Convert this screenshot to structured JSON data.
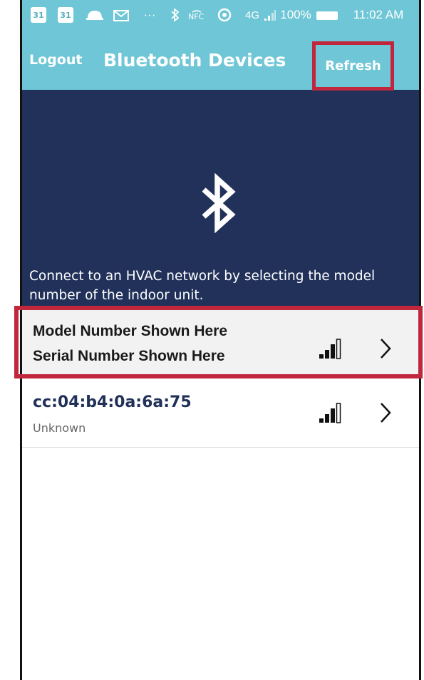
{
  "status_bar": {
    "cal_1": "31",
    "cal_2": "31",
    "network": "4G",
    "battery": "100%",
    "time": "11:02 AM",
    "icons": [
      "calendar-icon",
      "calendar-icon",
      "hat-icon",
      "mail-icon",
      "more-icon",
      "bluetooth-icon",
      "nfc-icon",
      "sync-icon",
      "signal-icon",
      "battery-icon"
    ]
  },
  "appbar": {
    "logout_label": "Logout",
    "title": "Bluetooth Devices",
    "refresh_label": "Refresh"
  },
  "hero": {
    "icon": "bluetooth-icon",
    "instruction": "Connect to an HVAC network by selecting the model number of the indoor unit."
  },
  "devices": [
    {
      "line1": "Model Number Shown Here",
      "line2": "Serial Number Shown Here",
      "signal_icon": "signal-strength-icon",
      "chevron_icon": "chevron-right-icon"
    },
    {
      "line1": "cc:04:b4:0a:6a:75",
      "line2": "Unknown",
      "signal_icon": "signal-strength-icon",
      "chevron_icon": "chevron-right-icon"
    }
  ],
  "colors": {
    "header": "#6fc6d6",
    "hero": "#213159",
    "highlight": "#c1273c"
  }
}
